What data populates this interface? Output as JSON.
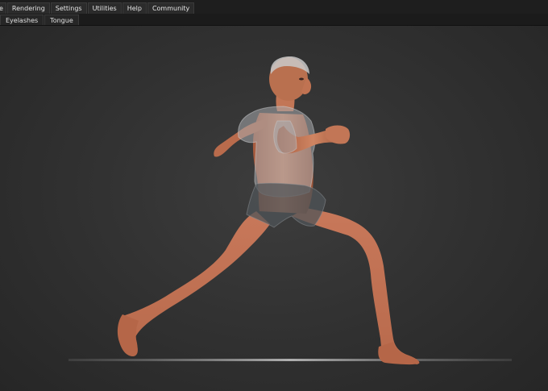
{
  "menubar": {
    "items": [
      {
        "label": "e"
      },
      {
        "label": "Rendering"
      },
      {
        "label": "Settings"
      },
      {
        "label": "Utilities"
      },
      {
        "label": "Help"
      },
      {
        "label": "Community"
      }
    ]
  },
  "tabbar": {
    "tabs": [
      {
        "label": "Eyelashes"
      },
      {
        "label": "Tongue"
      }
    ]
  },
  "colors": {
    "viewport_bg": "#333333",
    "skin": "#c97a58",
    "clothing": "#9aa0a4"
  }
}
